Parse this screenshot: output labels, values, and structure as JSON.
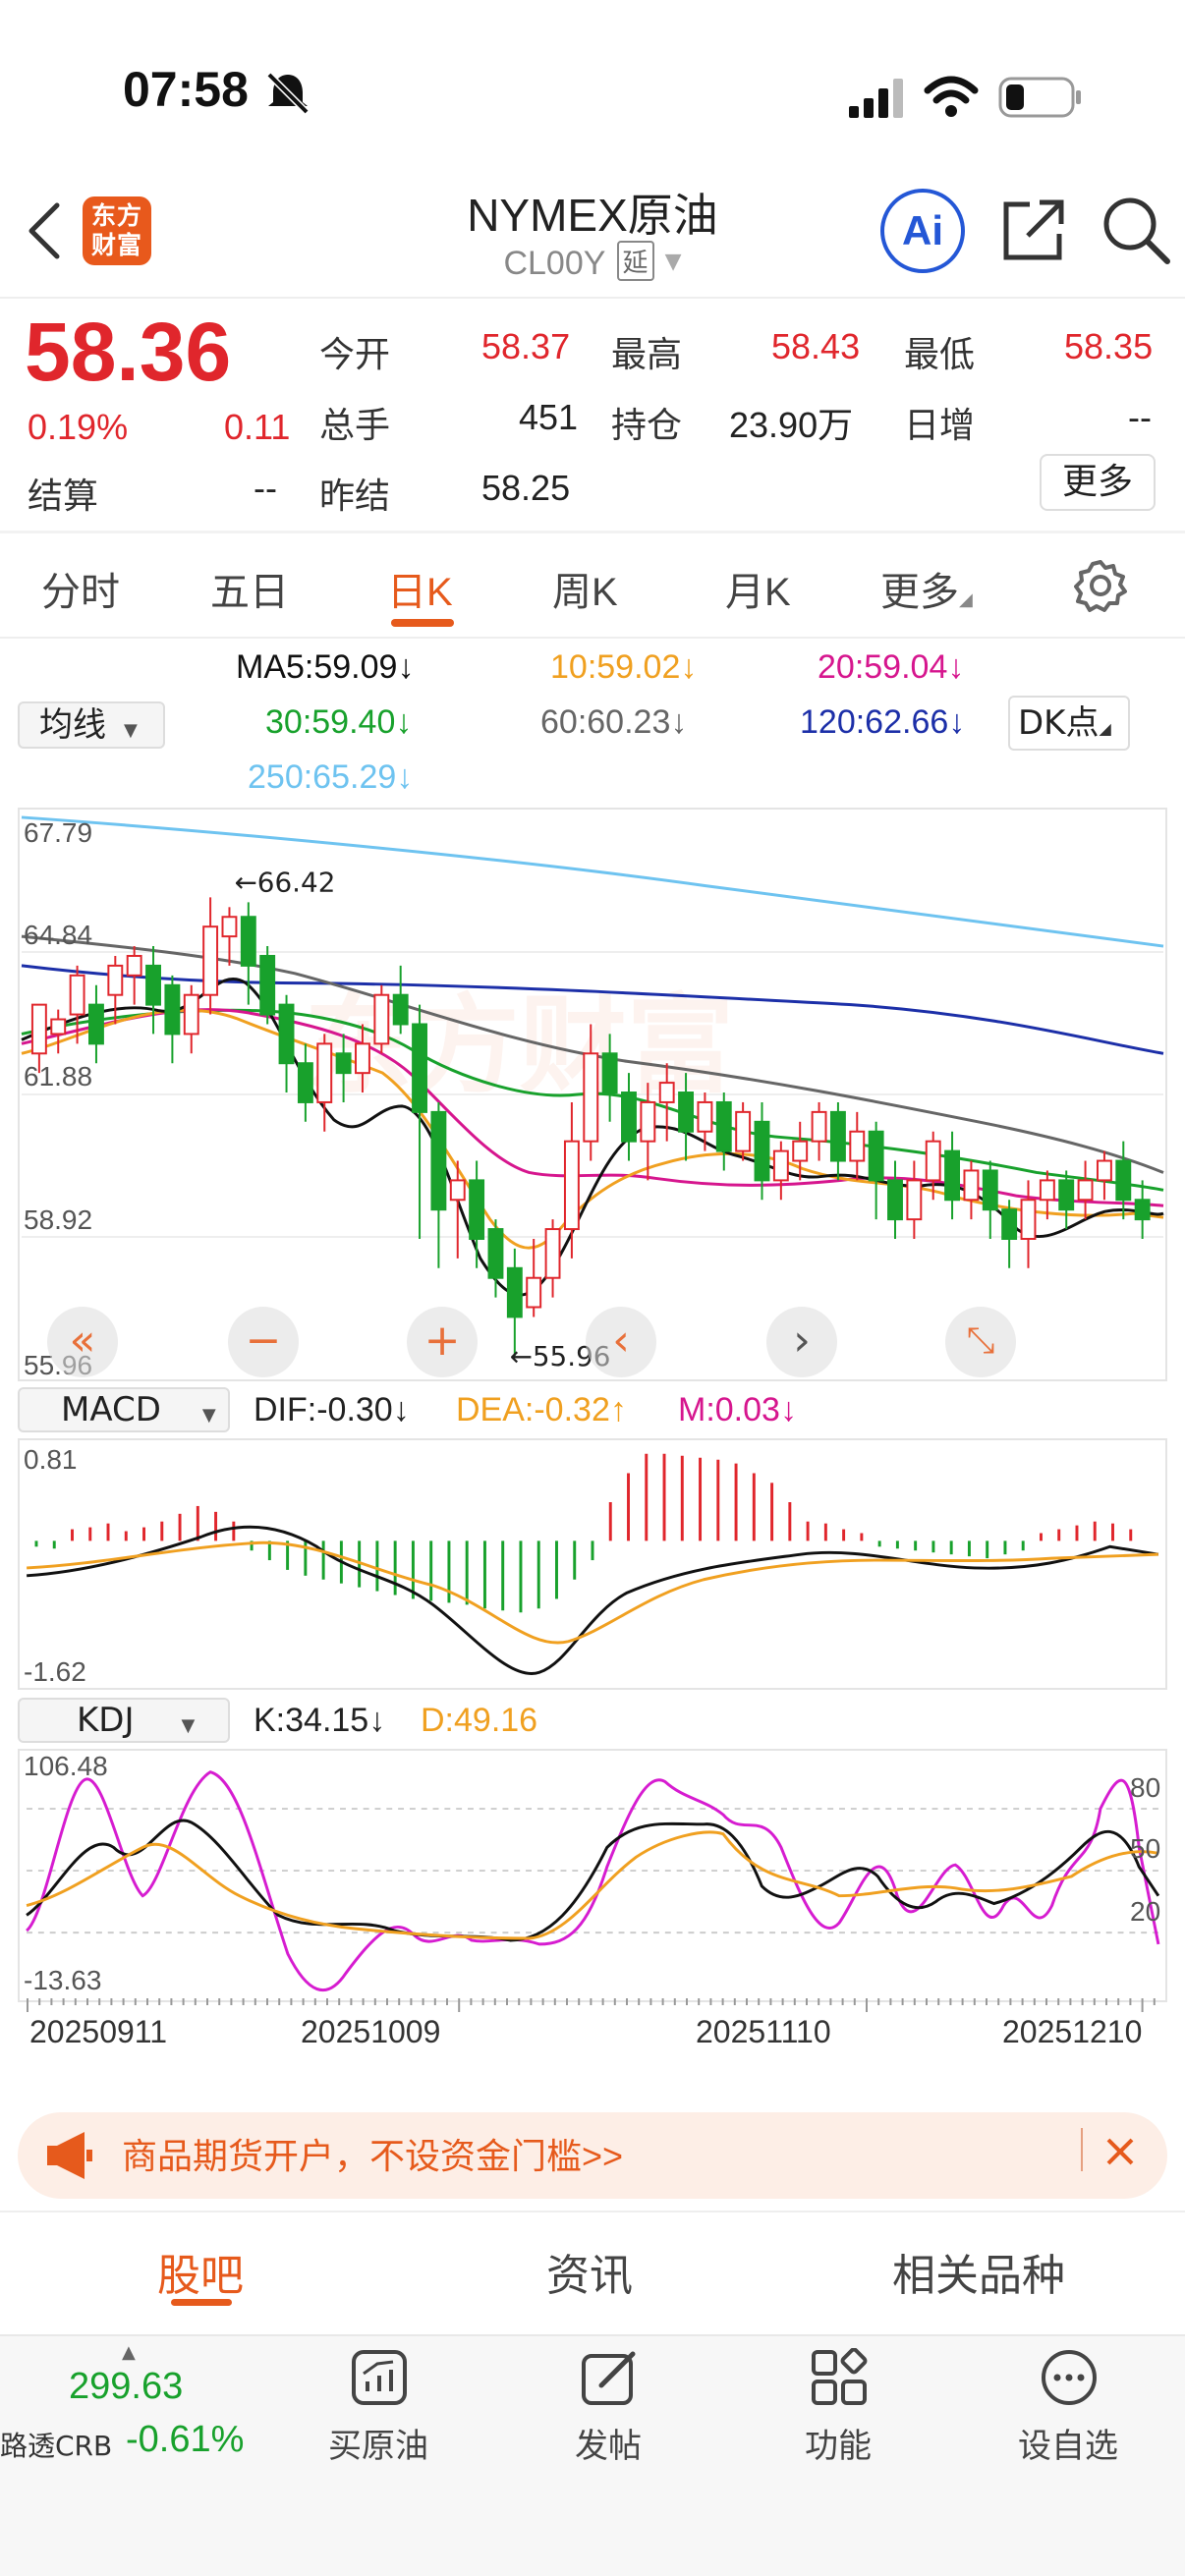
{
  "status_bar": {
    "time": "07:58"
  },
  "header": {
    "logo_text": "东方财富",
    "title": "NYMEX原油",
    "code": "CL00Y",
    "delay_tag": "延",
    "ai_label": "Ai"
  },
  "quote": {
    "price": "58.36",
    "change_pct": "0.19%",
    "change": "0.11",
    "open_label": "今开",
    "open": "58.37",
    "high_label": "最高",
    "high": "58.43",
    "low_label": "最低",
    "low": "58.35",
    "volume_label": "总手",
    "volume": "451",
    "oi_label": "持仓",
    "oi": "23.90万",
    "daily_inc_label": "日增",
    "daily_inc": "--",
    "settle_label": "结算",
    "settle": "--",
    "prev_settle_label": "昨结",
    "prev_settle": "58.25",
    "more_button": "更多"
  },
  "tabs": [
    {
      "label": "分时"
    },
    {
      "label": "五日"
    },
    {
      "label": "日K"
    },
    {
      "label": "周K"
    },
    {
      "label": "月K"
    },
    {
      "label": "更多"
    }
  ],
  "ma": {
    "selector": "均线",
    "ma5": "MA5:59.09↓",
    "ma10": "10:59.02↓",
    "ma20": "20:59.04↓",
    "ma30": "30:59.40↓",
    "ma60": "60:60.23↓",
    "ma120": "120:62.66↓",
    "ma250": "250:65.29↓",
    "dk_button": "DK点"
  },
  "colors": {
    "up": "#e0262c",
    "down": "#18a12c",
    "accent": "#e65a1c",
    "ma5": "#111111",
    "ma10": "#f0a020",
    "ma20": "#d6168e",
    "ma30": "#18a12c",
    "ma60": "#666666",
    "ma120": "#1c2fa8",
    "ma250": "#6ec3f0"
  },
  "main_chart": {
    "ylabels": [
      "67.79",
      "64.84",
      "61.88",
      "58.92",
      "55.96"
    ],
    "high_marker": "66.42",
    "low_marker": "55.96",
    "ylim": [
      55.96,
      67.79
    ]
  },
  "macd": {
    "selector": "MACD",
    "dif": "DIF:-0.30↓",
    "dea": "DEA:-0.32↑",
    "m": "M:0.03↓",
    "ylabels": [
      "0.81",
      "-1.62"
    ]
  },
  "kdj": {
    "selector": "KDJ",
    "k": "K:34.15↓",
    "d": "D:49.16",
    "ylabels": [
      "106.48",
      "-13.63"
    ],
    "rlabels": [
      "80",
      "50",
      "20"
    ]
  },
  "dates": [
    "20250911",
    "20251009",
    "20251110",
    "20251210"
  ],
  "banner": {
    "text": "商品期货开户，不设资金门槛>>"
  },
  "bottom_tabs": [
    {
      "label": "股吧"
    },
    {
      "label": "资讯"
    },
    {
      "label": "相关品种"
    }
  ],
  "bottom_bar": {
    "index_value": "299.63",
    "index_name": "路透CRB",
    "index_change": "-0.61%",
    "buttons": [
      {
        "label": "买原油"
      },
      {
        "label": "发帖"
      },
      {
        "label": "功能"
      },
      {
        "label": "设自选"
      }
    ]
  }
}
